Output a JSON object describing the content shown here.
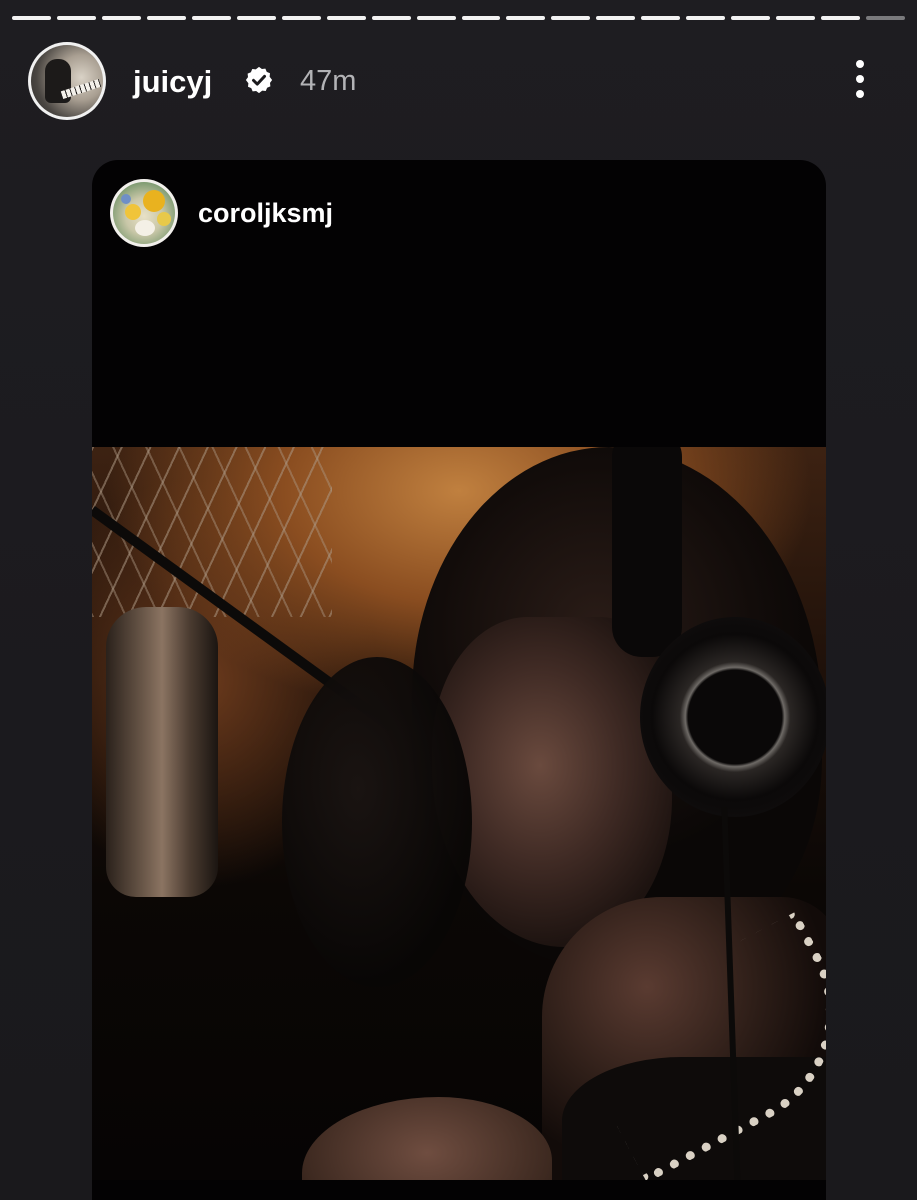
{
  "story": {
    "progress": {
      "total_segments": 20,
      "completed_segments": 19
    },
    "header": {
      "username": "juicyj",
      "verified": true,
      "verified_icon": "verified-badge-icon",
      "timestamp": "47m",
      "more_icon": "more-vertical-icon"
    },
    "shared_post": {
      "username": "coroljksmj",
      "content": "video"
    }
  },
  "colors": {
    "background": "#1c1b1e",
    "card_background": "#030203",
    "text_primary": "#ffffff",
    "text_secondary": "#b3b3b6",
    "progress_active": "#f2f2f2",
    "progress_pending": "#7a7a7d"
  }
}
